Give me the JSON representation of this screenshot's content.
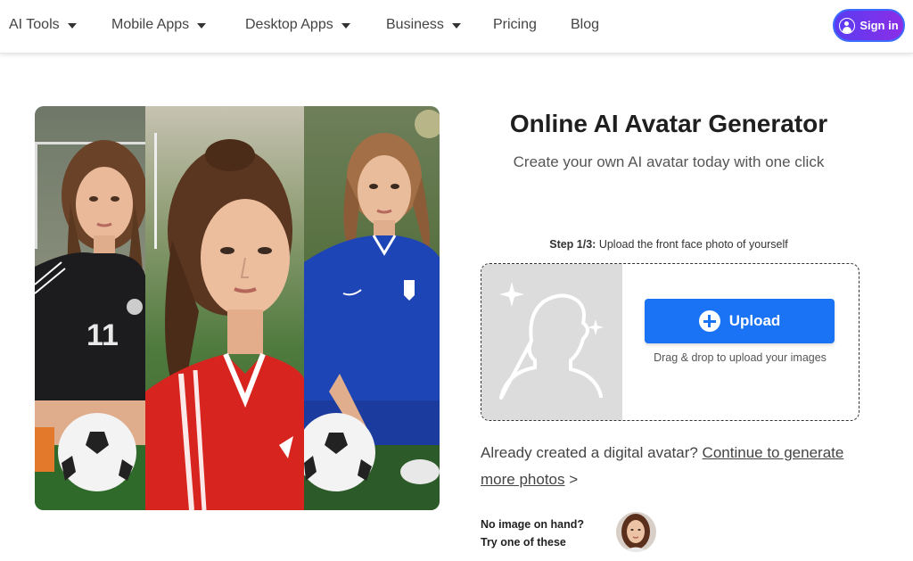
{
  "nav": {
    "items": [
      {
        "label": "AI Tools",
        "dropdown": true
      },
      {
        "label": "Mobile Apps",
        "dropdown": true
      },
      {
        "label": "Desktop Apps",
        "dropdown": true
      },
      {
        "label": "Business",
        "dropdown": true
      },
      {
        "label": "Pricing",
        "dropdown": false
      },
      {
        "label": "Blog",
        "dropdown": false
      }
    ],
    "signin_label": "Sign in"
  },
  "hero": {
    "alt": "Three portraits of a young woman in soccer jerseys (black, red, blue) holding soccer balls"
  },
  "main": {
    "title": "Online AI Avatar Generator",
    "subtitle": "Create your own AI avatar today with one click",
    "step_prefix": "Step 1/3:",
    "step_text": " Upload the front face photo of yourself",
    "upload_label": "Upload",
    "drag_text": "Drag & drop to upload your images",
    "already_text": "Already created a digital avatar? ",
    "continue_link": "Continue to generate more photos",
    "continue_suffix": " >",
    "no_image_line1": "No image on hand?",
    "no_image_line2": "Try one of these"
  },
  "colors": {
    "accent_blue": "#1a73f5",
    "signin_gradient_start": "#5a3cf2",
    "signin_gradient_end": "#8b2ee6"
  }
}
